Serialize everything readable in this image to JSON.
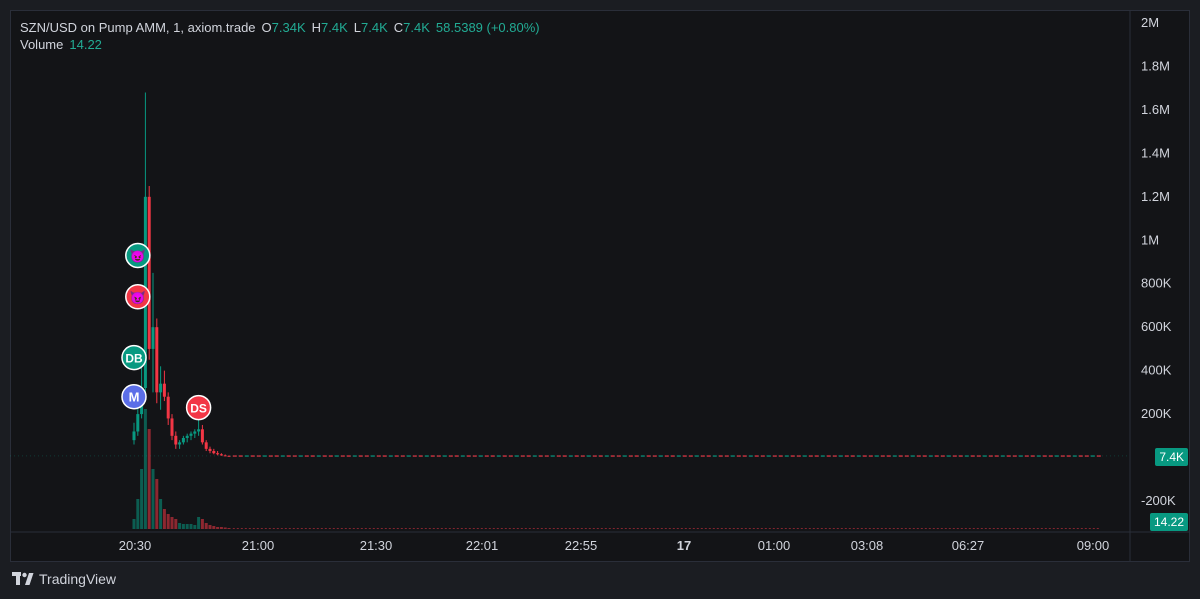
{
  "legend": {
    "symbol": "SZN/USD on Pump AMM, 1, axiom.trade",
    "o_label": "O",
    "o_value": "7.34K",
    "h_label": "H",
    "h_value": "7.4K",
    "l_label": "L",
    "l_value": "7.4K",
    "c_label": "C",
    "c_value": "7.4K",
    "change": "58.5389 (+0.80%)",
    "volume_label": "Volume",
    "volume_value": "14.22"
  },
  "price_tag": "7.4K",
  "volume_tag": "14.22",
  "brand": "TradingView",
  "colors": {
    "up": "#089981",
    "down": "#f23645",
    "background": "#131417",
    "text": "#d1d4dc"
  },
  "chart_data": {
    "type": "candlestick",
    "y_ticks": [
      "2M",
      "1.8M",
      "1.6M",
      "1.4M",
      "1.2M",
      "1M",
      "800K",
      "600K",
      "400K",
      "200K",
      "-200K"
    ],
    "y_tick_values": [
      2000000,
      1800000,
      1600000,
      1400000,
      1200000,
      1000000,
      800000,
      600000,
      400000,
      200000,
      -200000
    ],
    "ylim": [
      -300000,
      2100000
    ],
    "x_ticks": [
      "20:30",
      "21:00",
      "21:30",
      "22:01",
      "22:55",
      "17",
      "01:00",
      "03:08",
      "06:27",
      "09:00"
    ],
    "last_price": 7400,
    "candles": [
      {
        "o": 80000,
        "h": 160000,
        "l": 60000,
        "c": 120000,
        "v": 1
      },
      {
        "o": 120000,
        "h": 240000,
        "l": 100000,
        "c": 200000,
        "v": 3
      },
      {
        "o": 200000,
        "h": 420000,
        "l": 180000,
        "c": 320000,
        "v": 6
      },
      {
        "o": 320000,
        "h": 1680000,
        "l": 280000,
        "c": 1200000,
        "v": 12
      },
      {
        "o": 1200000,
        "h": 1250000,
        "l": 450000,
        "c": 500000,
        "v": 10
      },
      {
        "o": 500000,
        "h": 850000,
        "l": 300000,
        "c": 600000,
        "v": 6
      },
      {
        "o": 600000,
        "h": 640000,
        "l": 250000,
        "c": 300000,
        "v": 5
      },
      {
        "o": 300000,
        "h": 420000,
        "l": 220000,
        "c": 340000,
        "v": 3
      },
      {
        "o": 340000,
        "h": 400000,
        "l": 260000,
        "c": 280000,
        "v": 2
      },
      {
        "o": 280000,
        "h": 300000,
        "l": 150000,
        "c": 180000,
        "v": 1.5
      },
      {
        "o": 180000,
        "h": 200000,
        "l": 80000,
        "c": 100000,
        "v": 1.2
      },
      {
        "o": 100000,
        "h": 120000,
        "l": 40000,
        "c": 60000,
        "v": 1
      },
      {
        "o": 60000,
        "h": 80000,
        "l": 40000,
        "c": 70000,
        "v": 0.6
      },
      {
        "o": 70000,
        "h": 100000,
        "l": 60000,
        "c": 90000,
        "v": 0.5
      },
      {
        "o": 90000,
        "h": 110000,
        "l": 70000,
        "c": 100000,
        "v": 0.5
      },
      {
        "o": 100000,
        "h": 120000,
        "l": 80000,
        "c": 110000,
        "v": 0.5
      },
      {
        "o": 110000,
        "h": 130000,
        "l": 90000,
        "c": 120000,
        "v": 0.4
      },
      {
        "o": 120000,
        "h": 180000,
        "l": 100000,
        "c": 130000,
        "v": 1.2
      },
      {
        "o": 130000,
        "h": 150000,
        "l": 60000,
        "c": 70000,
        "v": 1
      },
      {
        "o": 70000,
        "h": 80000,
        "l": 30000,
        "c": 40000,
        "v": 0.6
      },
      {
        "o": 40000,
        "h": 50000,
        "l": 20000,
        "c": 30000,
        "v": 0.4
      },
      {
        "o": 30000,
        "h": 40000,
        "l": 15000,
        "c": 20000,
        "v": 0.3
      },
      {
        "o": 20000,
        "h": 30000,
        "l": 10000,
        "c": 15000,
        "v": 0.2
      },
      {
        "o": 15000,
        "h": 20000,
        "l": 8000,
        "c": 10000,
        "v": 0.2
      },
      {
        "o": 10000,
        "h": 14000,
        "l": 7000,
        "c": 8000,
        "v": 0.15
      },
      {
        "o": 8000,
        "h": 10000,
        "l": 7000,
        "c": 7400,
        "v": 0.1
      }
    ],
    "markers": [
      {
        "label": "😈",
        "kind": "up",
        "candle": 1,
        "value": 930000
      },
      {
        "label": "😈",
        "kind": "down",
        "candle": 1,
        "value": 740000
      },
      {
        "label": "DB",
        "kind": "up",
        "candle": 0,
        "value": 460000
      },
      {
        "label": "M",
        "kind": "blue",
        "candle": 0,
        "value": 280000
      },
      {
        "label": "DS",
        "kind": "down",
        "candle": 17,
        "value": 230000
      }
    ]
  }
}
